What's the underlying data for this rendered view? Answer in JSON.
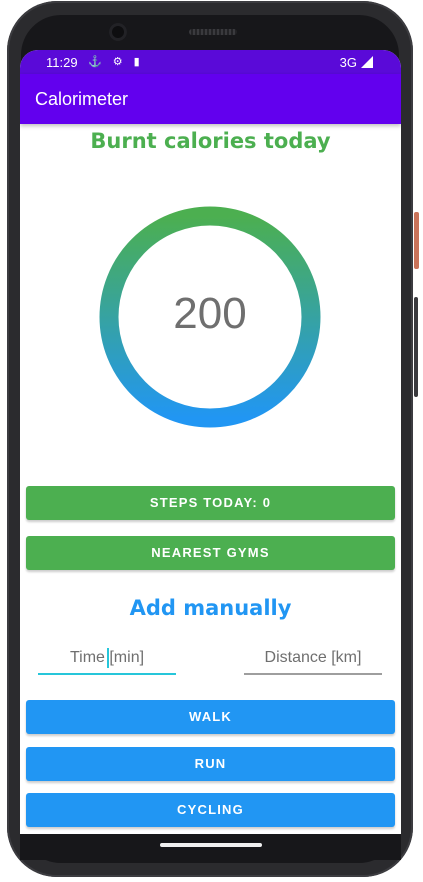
{
  "status_bar": {
    "time": "11:29",
    "icons": "⚓ ⚙ ▮",
    "network": "3G"
  },
  "app_bar": {
    "title": "Calorimeter"
  },
  "main": {
    "heading": "Burnt calories today",
    "calories_value": "200",
    "ring_colors": {
      "top": "#4caf50",
      "bottom": "#2196f3"
    },
    "steps_button": "STEPS TODAY: 0",
    "gyms_button": "NEAREST GYMS",
    "manual_heading": "Add manually",
    "time_input": {
      "placeholder": "Time [min]",
      "value": ""
    },
    "distance_input": {
      "placeholder": "Distance [km]",
      "value": ""
    },
    "activity_buttons": [
      "WALK",
      "RUN",
      "CYCLING"
    ]
  },
  "colors": {
    "primary": "#6200ee",
    "primary_dark": "#5a0ad8",
    "green": "#4caf50",
    "blue": "#2196f3",
    "accent": "#26c6da"
  }
}
